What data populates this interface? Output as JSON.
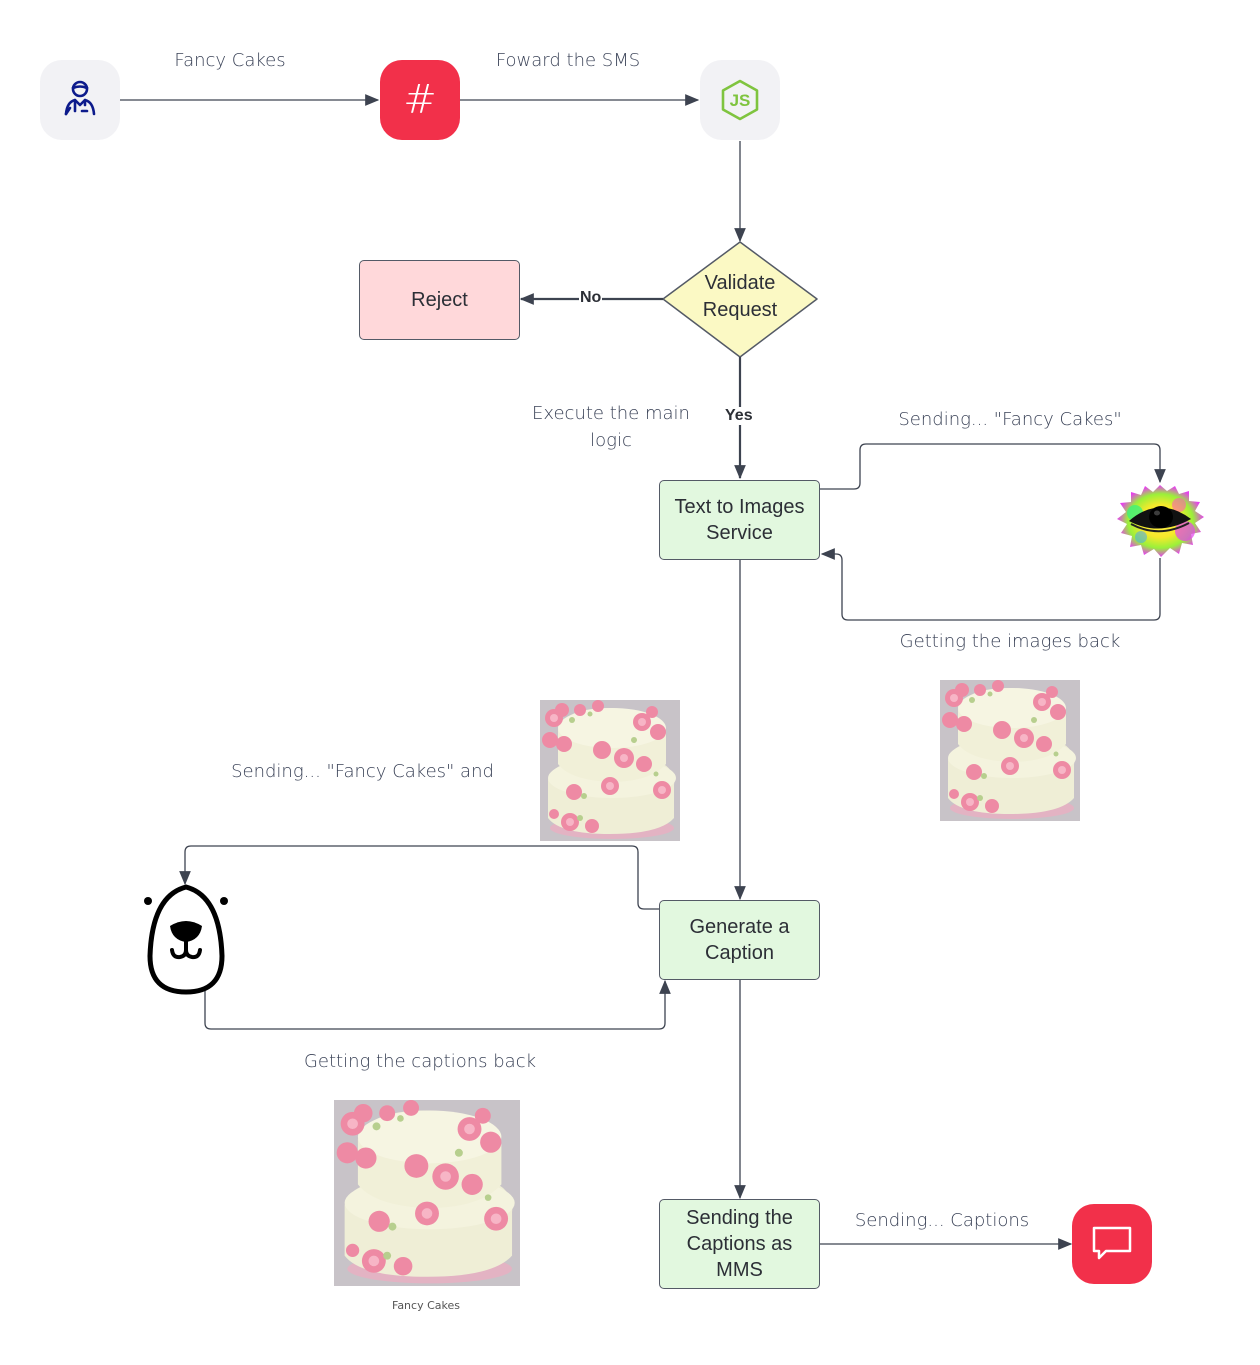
{
  "diagram": {
    "nodes": {
      "user": {
        "icon": "user-person-icon",
        "accent": "#0d1b8c"
      },
      "hash": {
        "icon": "hashtag-icon",
        "label": "#",
        "color": "#f2304a"
      },
      "nodejs": {
        "icon": "nodejs-icon",
        "label": "JS",
        "color": "#7fc43f"
      },
      "validate": {
        "label_line1": "Validate",
        "label_line2": "Request",
        "color": "#fbf9c4"
      },
      "reject": {
        "label": "Reject",
        "color": "#ffd8da"
      },
      "text_to_images": {
        "label_line1": "Text to Images",
        "label_line2": "Service",
        "color": "#e2f8df"
      },
      "image_ai": {
        "icon": "colorful-eye-icon"
      },
      "generate_caption": {
        "label_line1": "Generate a",
        "label_line2": "Caption",
        "color": "#e2f8df"
      },
      "caption_ai": {
        "icon": "bear-face-icon"
      },
      "send_mms": {
        "label_line1": "Sending the",
        "label_line2": "Captions as",
        "label_line3": "MMS",
        "color": "#e2f8df"
      },
      "message": {
        "icon": "chat-bubble-icon",
        "color": "#f2304a"
      }
    },
    "edge_labels": {
      "user_to_hash": "Fancy Cakes",
      "hash_to_nodejs": "Foward the SMS",
      "no_branch": "No",
      "yes_branch": "Yes",
      "execute_line1": "Execute the main",
      "execute_line2": "logic",
      "sending_to_image_ai": "Sending... \"Fancy Cakes\"",
      "images_back": "Getting the images back",
      "sending_to_caption_ai": "Sending... \"Fancy Cakes\" and",
      "captions_back": "Getting the captions back",
      "sending_captions": "Sending... Captions"
    },
    "images": {
      "cake_image_1": {
        "alt": "cake-image"
      },
      "cake_image_2": {
        "alt": "cake-image"
      },
      "cake_image_3": {
        "alt": "cake-image",
        "caption": "Fancy Cakes"
      }
    },
    "colors": {
      "line": "#3d4350",
      "text": "#3a4257"
    }
  }
}
